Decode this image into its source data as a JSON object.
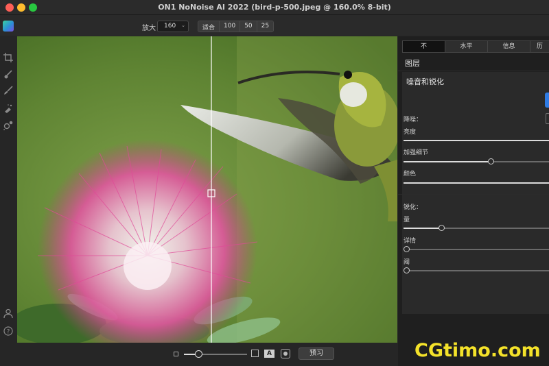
{
  "window": {
    "title": "ON1 NoNoise AI 2022 (bird-p-500.jpeg @ 160.0% 8-bit)"
  },
  "toolbar": {
    "zoom_label": "放大",
    "zoom_value": "160",
    "zoom_presets": [
      "适合",
      "100",
      "50",
      "25"
    ]
  },
  "tools": [
    "crop-icon",
    "brush-icon",
    "pen-brush-icon",
    "retouch-icon",
    "zoom-tool-icon",
    "user-icon",
    "help-icon"
  ],
  "bottom": {
    "preview_label": "预习",
    "a_label": "A"
  },
  "panel": {
    "tabs": [
      "不",
      "水平",
      "信息",
      "历"
    ],
    "active_tab": 0,
    "layers_title": "图层",
    "section_title": "噪音和锐化",
    "noise_heading": "降噪：",
    "noise_sliders": [
      {
        "label": "亮度",
        "value": 1.0
      },
      {
        "label": "加强细节",
        "value": 0.6
      },
      {
        "label": "颜色",
        "value": 1.0
      }
    ],
    "sharpen_heading": "锐化：",
    "sharpen_sliders": [
      {
        "label": "量",
        "value": 0.26
      },
      {
        "label": "详情",
        "value": 0.0
      },
      {
        "label": "阈",
        "value": 0.0
      }
    ]
  },
  "watermark": "CGtimo.com",
  "colors": {
    "accent": "#2f7be3",
    "watermark": "#f4e22a",
    "panel_bg": "#1f1f1f",
    "section_bg": "#2a2a2a"
  }
}
